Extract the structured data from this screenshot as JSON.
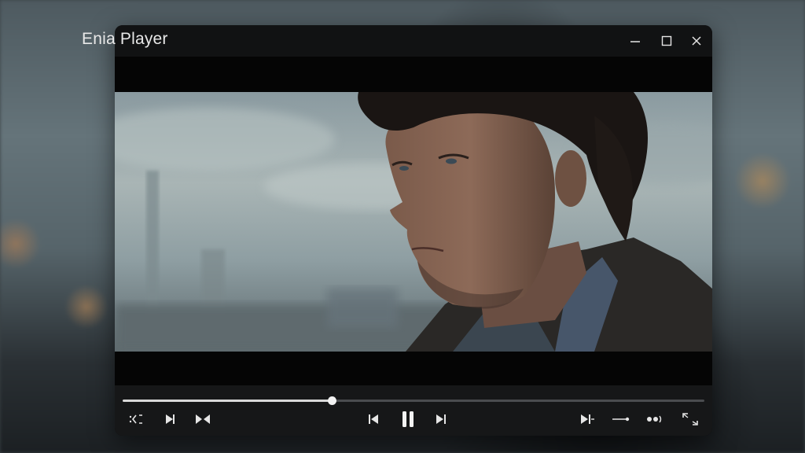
{
  "window": {
    "title": "Enia Player"
  },
  "titlebar": {
    "minimize_icon": "minimize-icon",
    "maximize_icon": "maximize-icon",
    "close_icon": "close-icon"
  },
  "player": {
    "progress": 0.36
  },
  "controls": {
    "left": [
      "shuffle-icon",
      "next-frame-icon",
      "step-icon"
    ],
    "center": [
      "skip-back-icon",
      "pause-icon",
      "skip-forward-icon"
    ],
    "right": [
      "chapter-next-icon",
      "subtitle-track-icon",
      "audio-track-icon",
      "fullscreen-icon"
    ]
  },
  "colors": {
    "window_bg": "#0c0c0d",
    "controls_bg": "#161718",
    "accent": "#e6e6e6"
  }
}
